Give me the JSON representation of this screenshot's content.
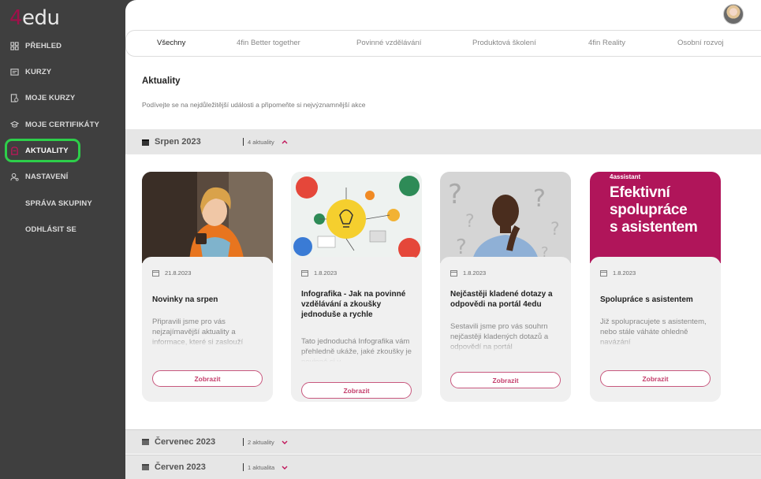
{
  "logo": {
    "num": "4",
    "text": "edu"
  },
  "sidebar": {
    "items": [
      {
        "label": "PŘEHLED",
        "icon": "dashboard-icon"
      },
      {
        "label": "KURZY",
        "icon": "course-icon"
      },
      {
        "label": "MOJE KURZY",
        "icon": "my-courses-icon"
      },
      {
        "label": "MOJE CERTIFIKÁTY",
        "icon": "certificate-icon"
      },
      {
        "label": "AKTUALITY",
        "icon": "news-icon"
      },
      {
        "label": "NASTAVENÍ",
        "icon": "settings-user-icon"
      },
      {
        "label": "SPRÁVA SKUPINY"
      },
      {
        "label": "ODHLÁSIT SE"
      }
    ]
  },
  "tabs": [
    "Všechny",
    "4fin Better together",
    "Povinné vzdělávání",
    "Produktová školení",
    "4fin Reality",
    "Osobní rozvoj"
  ],
  "page": {
    "title": "Aktuality",
    "subtitle": "Podívejte se na nejdůležitější události a připomeňte si nejvýznamnější akce"
  },
  "months": [
    {
      "name": "Srpen 2023",
      "count": "4 aktuality"
    },
    {
      "name": "Červenec 2023",
      "count": "2 aktuality"
    },
    {
      "name": "Červen 2023",
      "count": "1 aktualita"
    }
  ],
  "cards": [
    {
      "date": "21.8.2023",
      "title": "Novinky na srpen",
      "desc": "Připravili jsme pro vás nejzajímavější aktuality a informace, které si zaslouží",
      "button": "Zobrazit"
    },
    {
      "date": "1.8.2023",
      "title": "Infografika - Jak na povinné vzdělávání a zkoušky jednoduše a rychle",
      "desc": "Tato jednoduchá Infografika vám přehledně ukáže, jaké zkoušky je povinné si v",
      "button": "Zobrazit"
    },
    {
      "date": "1.8.2023",
      "title": "Nejčastěji kladené dotazy a odpovědi na portál 4edu",
      "desc": "Sestavili jsme pro vás souhrn nejčastěji kladených dotazů a odpovědí na portál",
      "button": "Zobrazit"
    },
    {
      "date": "1.8.2023",
      "title": "Spolupráce s asistentem",
      "desc": "Již spolupracujete s asistentem, nebo stále váháte ohledně navázání",
      "button": "Zobrazit",
      "image_brand": "4assistant",
      "image_text": [
        "Efektivní",
        "spolupráce",
        "s asistentem"
      ]
    }
  ],
  "colors": {
    "accent": "#a0104a",
    "sidebar_bg": "#3f3f3f",
    "active_ring": "#2dcf4a",
    "magenta": "#b0155a"
  }
}
